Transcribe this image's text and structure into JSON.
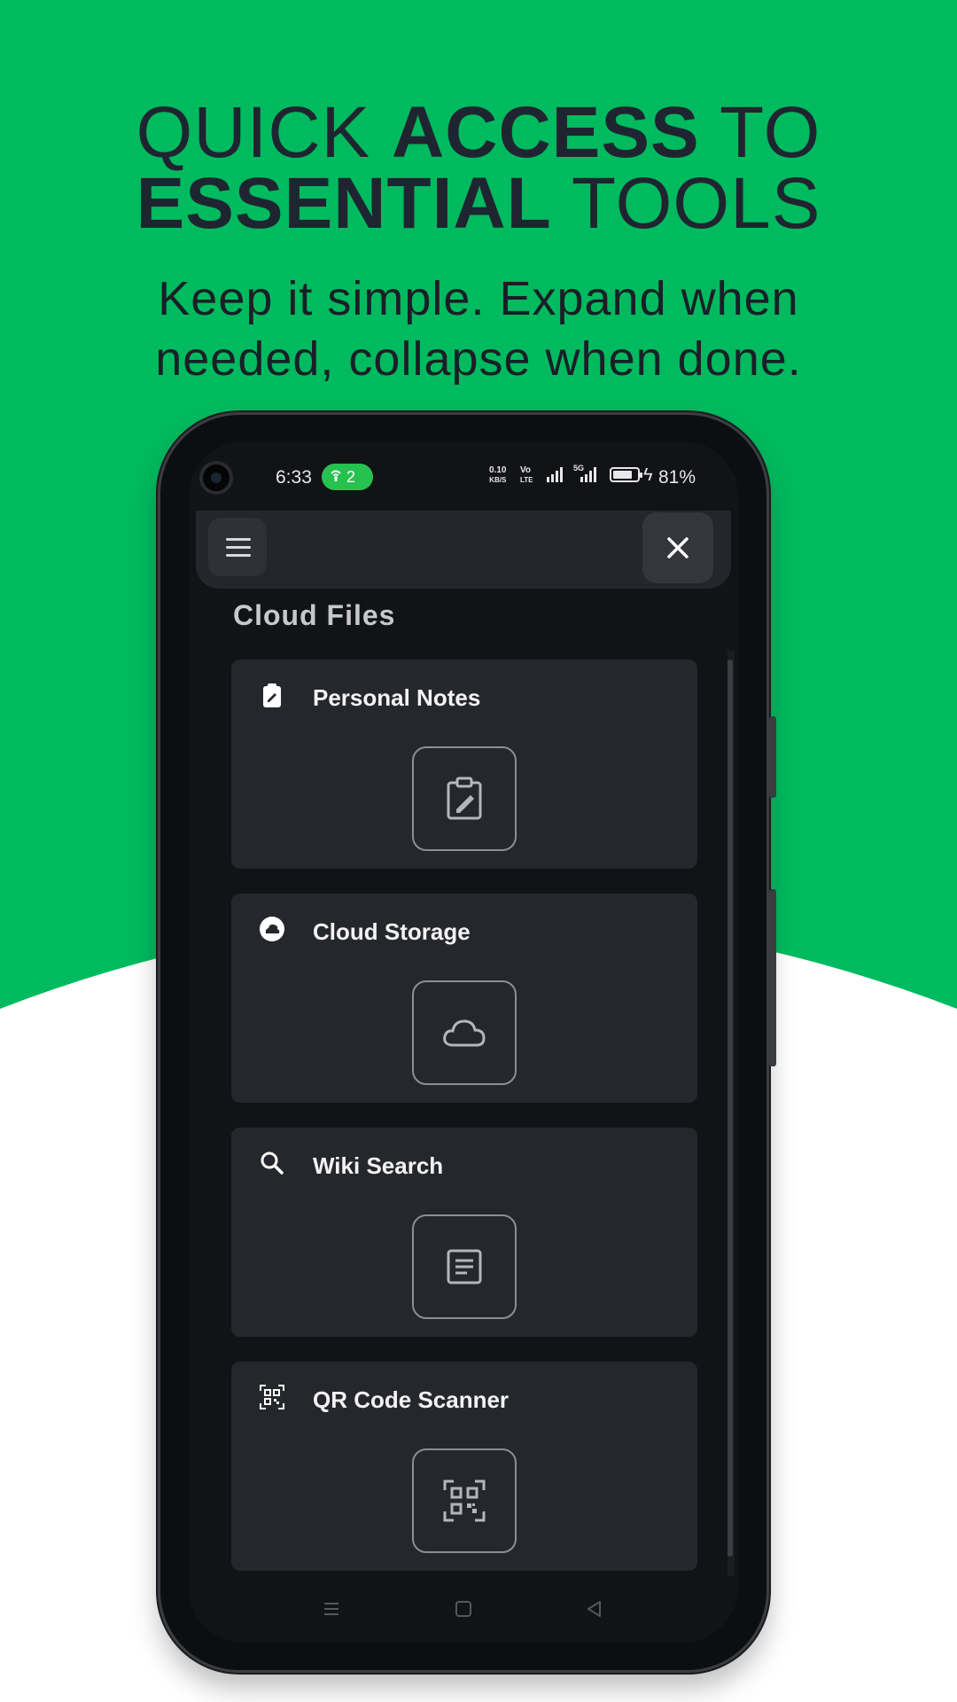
{
  "promo": {
    "headline_line1_a": "QUICK ",
    "headline_line1_b": "ACCESS",
    "headline_line1_c": " TO",
    "headline_line2_a": "ESSENTIAL",
    "headline_line2_b": " TOOLS",
    "subhead_line1": "Keep it simple. Expand when",
    "subhead_line2": "needed, collapse when done."
  },
  "colors": {
    "brand_green": "#00BA5F",
    "hotspot_green": "#26C24F",
    "screen_bg": "#121316",
    "card_bg": "#25272C"
  },
  "status_bar": {
    "time": "6:33",
    "hotspot_count": "2",
    "net_speed_value": "0.10",
    "net_speed_unit": "KB/S",
    "volte_top": "Vo",
    "volte_bottom": "LTE",
    "sig2_label": "5G",
    "battery_percent": "81%",
    "battery_level": 0.81
  },
  "app_bar": {
    "menu_icon": "hamburger-icon",
    "close_icon": "close-icon"
  },
  "section": {
    "title": "Cloud Files"
  },
  "cards": [
    {
      "title": "Personal Notes",
      "icon": "clipboard-icon",
      "action_icon": "clipboard-edit-icon"
    },
    {
      "title": "Cloud Storage",
      "icon": "cloud-icon",
      "action_icon": "cloud-outline-icon"
    },
    {
      "title": "Wiki Search",
      "icon": "search-icon",
      "action_icon": "article-icon"
    },
    {
      "title": "QR Code Scanner",
      "icon": "qr-code-icon",
      "action_icon": "qr-code-icon"
    }
  ],
  "nav": {
    "recents_icon": "recents-icon",
    "home_icon": "home-icon",
    "back_icon": "back-icon"
  }
}
